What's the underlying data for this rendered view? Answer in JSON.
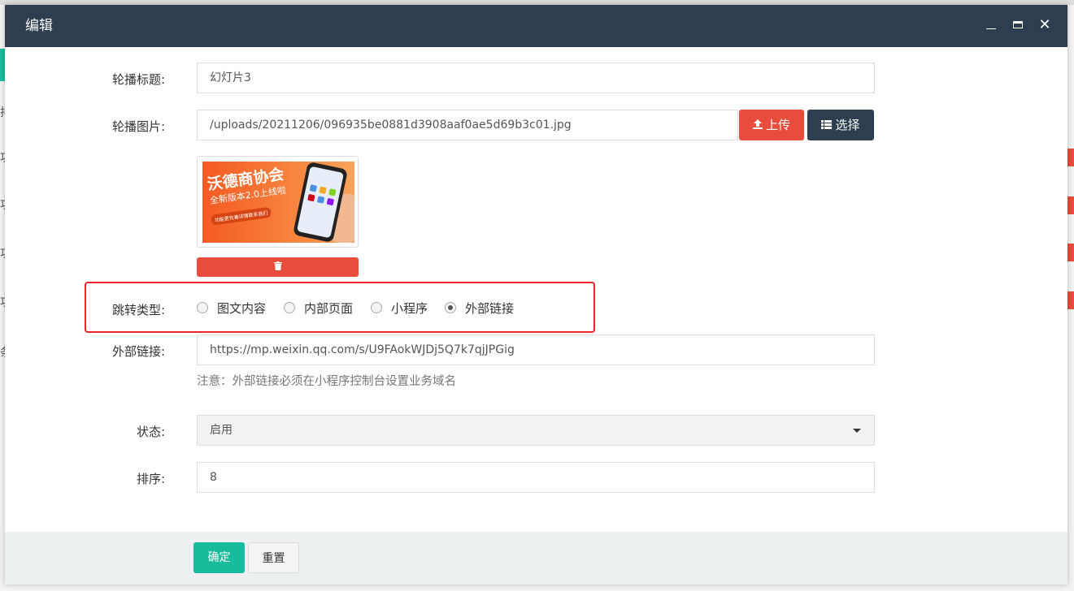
{
  "background": {
    "left_chars": [
      "排",
      "功",
      "功",
      "功",
      "功",
      "条"
    ]
  },
  "dialog": {
    "title": "编辑",
    "controls": {
      "minimize_icon": "minimize-icon",
      "maximize_icon": "maximize-icon",
      "close_glyph": "✕"
    }
  },
  "form": {
    "title": {
      "label": "轮播标题:",
      "value": "幻灯片3"
    },
    "image": {
      "label": "轮播图片:",
      "value": "/uploads/20211206/096935be0881d3908aaf0ae5d69b3c01.jpg",
      "upload_label": "上传",
      "choose_label": "选择",
      "preview": {
        "headline": "沃德商协会",
        "subline": "全新版本2.0上线啦",
        "tagline": "功能更完善详情联系我们"
      },
      "delete_icon": "trash-icon"
    },
    "jump_type": {
      "label": "跳转类型:",
      "options": [
        "图文内容",
        "内部页面",
        "小程序",
        "外部链接"
      ],
      "selected": "外部链接"
    },
    "external_link": {
      "label": "外部链接:",
      "value": "https://mp.weixin.qq.com/s/U9FAokWJDj5Q7k7qjJPGig",
      "note": "注意：外部链接必须在小程序控制台设置业务域名"
    },
    "status": {
      "label": "状态:",
      "value": "启用"
    },
    "sort": {
      "label": "排序:",
      "value": "8"
    }
  },
  "footer": {
    "ok_label": "确定",
    "reset_label": "重置"
  },
  "colors": {
    "titlebar": "#2c3e50",
    "danger": "#e74c3c",
    "primary": "#18bc9c",
    "highlight": "#e8262b"
  }
}
